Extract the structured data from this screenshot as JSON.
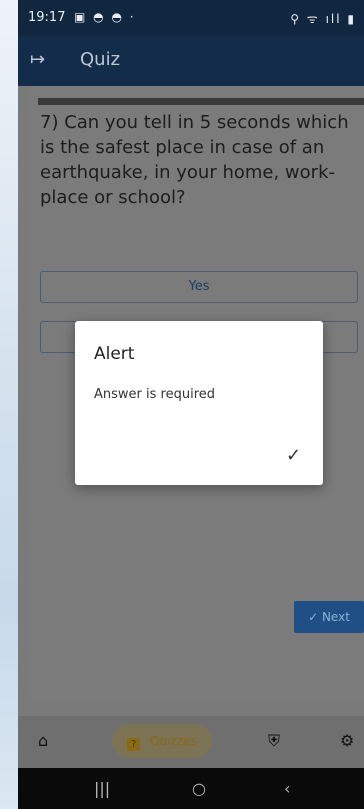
{
  "status_bar": {
    "time": "19:17",
    "notifications": "▣ ◓ ◓ ·",
    "system": "⚲ ᯤ ıll ▮"
  },
  "app_bar": {
    "exit_icon": "exit-icon",
    "title": "Quiz"
  },
  "quiz": {
    "question": "7) Can you tell in 5 seconds which is the safest place in case of an earthquake, in your home, work-place or school?",
    "answers": [
      "Yes",
      ""
    ],
    "next_label": "Next"
  },
  "dialog": {
    "title": "Alert",
    "message": "Answer is required",
    "ok_symbol": "✓"
  },
  "bottom_nav": {
    "quizzes_label": "Quizzes"
  },
  "colors": {
    "appbar": "#132c49",
    "statusbar": "#11263f",
    "accent": "#1f4f85",
    "nav_active": "#8a6a14"
  }
}
